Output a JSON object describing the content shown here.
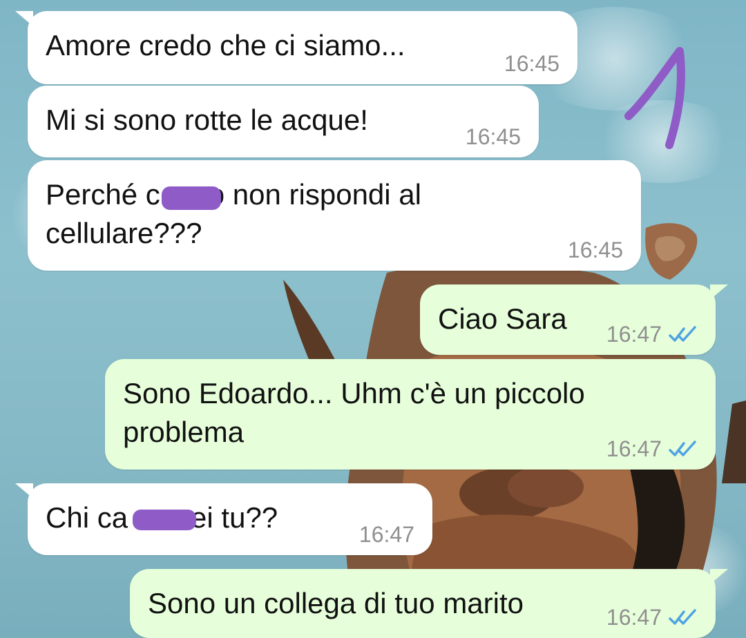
{
  "theme": {
    "incoming_bubble": "#ffffff",
    "outgoing_bubble": "#e6ffda",
    "timestamp_color": "#8f8f8f",
    "read_ticks_color": "#4fa3e3",
    "redaction_color": "#8e5bc7"
  },
  "messages": [
    {
      "text": "Amore credo che ci siamo...",
      "time": "16:45",
      "direction": "incoming"
    },
    {
      "text": "Mi si sono rotte le acque!",
      "time": "16:45",
      "direction": "incoming"
    },
    {
      "text": "Perché c      o non rispondi al\ncellulare???",
      "time": "16:45",
      "direction": "incoming"
    },
    {
      "text": "Ciao Sara",
      "time": "16:47",
      "direction": "outgoing",
      "status_icon": "double-check-icon"
    },
    {
      "text": "Sono Edoardo... Uhm c'è un piccolo\nproblema",
      "time": "16:47",
      "direction": "outgoing",
      "status_icon": "double-check-icon"
    },
    {
      "text": "Chi ca      sei tu??",
      "time": "16:47",
      "direction": "incoming"
    },
    {
      "text": "Sono un collega di tuo marito",
      "time": "16:47",
      "direction": "outgoing",
      "status_icon": "double-check-icon"
    }
  ]
}
